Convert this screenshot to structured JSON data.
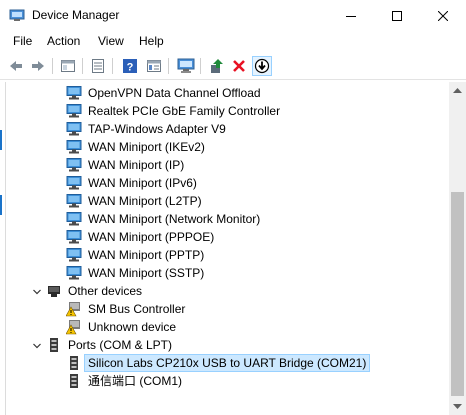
{
  "window": {
    "title": "Device Manager",
    "icon": "device-manager-icon"
  },
  "menu": [
    "File",
    "Action",
    "View",
    "Help"
  ],
  "toolbar": {
    "buttons": [
      "back-icon",
      "forward-icon",
      "properties-icon",
      "view-icon",
      "help-icon",
      "console-icon",
      "scan-hardware-icon",
      "update-driver-icon",
      "uninstall-icon",
      "disable-icon"
    ],
    "colors": {
      "uninstall": "#e81123",
      "update": "#1f8a3a"
    }
  },
  "tree": {
    "items": [
      {
        "label": "OpenVPN Data Channel Offload",
        "icon": "network-adapter-icon",
        "level": 2
      },
      {
        "label": "Realtek PCIe GbE Family Controller",
        "icon": "network-adapter-icon",
        "level": 2
      },
      {
        "label": "TAP-Windows Adapter V9",
        "icon": "network-adapter-icon",
        "level": 2
      },
      {
        "label": "WAN Miniport (IKEv2)",
        "icon": "network-adapter-icon",
        "level": 2
      },
      {
        "label": "WAN Miniport (IP)",
        "icon": "network-adapter-icon",
        "level": 2
      },
      {
        "label": "WAN Miniport (IPv6)",
        "icon": "network-adapter-icon",
        "level": 2
      },
      {
        "label": "WAN Miniport (L2TP)",
        "icon": "network-adapter-icon",
        "level": 2
      },
      {
        "label": "WAN Miniport (Network Monitor)",
        "icon": "network-adapter-icon",
        "level": 2
      },
      {
        "label": "WAN Miniport (PPPOE)",
        "icon": "network-adapter-icon",
        "level": 2
      },
      {
        "label": "WAN Miniport (PPTP)",
        "icon": "network-adapter-icon",
        "level": 2
      },
      {
        "label": "WAN Miniport (SSTP)",
        "icon": "network-adapter-icon",
        "level": 2
      },
      {
        "label": "Other devices",
        "icon": "other-devices-icon",
        "level": 1,
        "expanded": true
      },
      {
        "label": "SM Bus Controller",
        "icon": "warning-device-icon",
        "level": 2
      },
      {
        "label": "Unknown device",
        "icon": "warning-device-icon",
        "level": 2
      },
      {
        "label": "Ports (COM & LPT)",
        "icon": "port-icon",
        "level": 1,
        "expanded": true
      },
      {
        "label": "Silicon Labs CP210x USB to UART Bridge (COM21)",
        "icon": "port-icon",
        "level": 2,
        "selected": true
      },
      {
        "label": "通信端口 (COM1)",
        "icon": "port-icon",
        "level": 2
      }
    ],
    "selection_color": "#cce8ff"
  }
}
